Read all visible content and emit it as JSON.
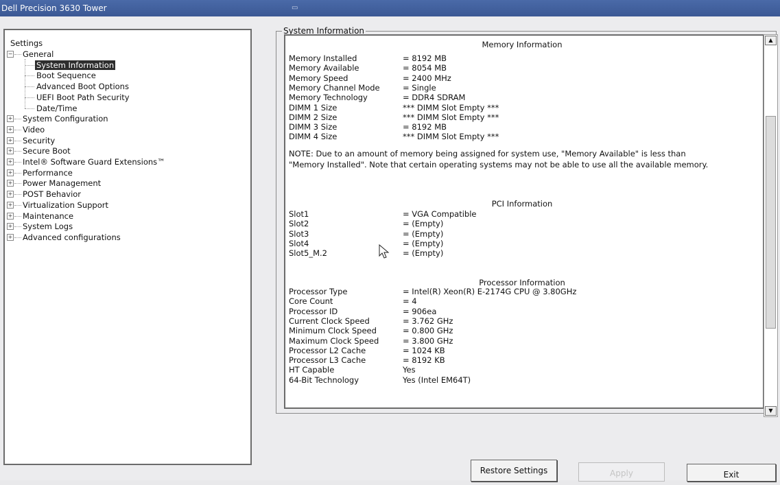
{
  "window": {
    "title": "Dell Precision 3630 Tower"
  },
  "tree": {
    "root": "Settings",
    "general": {
      "label": "General",
      "children": [
        "System Information",
        "Boot Sequence",
        "Advanced Boot Options",
        "UEFI Boot Path Security",
        "Date/Time"
      ],
      "selected": "System Information"
    },
    "top_items": [
      "System Configuration",
      "Video",
      "Security",
      "Secure Boot",
      "Intel® Software Guard Extensions™",
      "Performance",
      "Power Management",
      "POST Behavior",
      "Virtualization Support",
      "Maintenance",
      "System Logs",
      "Advanced configurations"
    ]
  },
  "panel": {
    "group_title": "System Information",
    "memory": {
      "title": "Memory Information",
      "rows": [
        {
          "k": "Memory Installed",
          "v": "= 8192 MB"
        },
        {
          "k": "Memory Available",
          "v": "= 8054 MB"
        },
        {
          "k": "Memory Speed",
          "v": "= 2400 MHz"
        },
        {
          "k": "Memory Channel Mode",
          "v": "= Single"
        },
        {
          "k": "Memory Technology",
          "v": "= DDR4 SDRAM"
        },
        {
          "k": "DIMM 1 Size",
          "v": "*** DIMM Slot Empty ***"
        },
        {
          "k": "DIMM 2 Size",
          "v": "*** DIMM Slot Empty ***"
        },
        {
          "k": "DIMM 3 Size",
          "v": "= 8192 MB"
        },
        {
          "k": "DIMM 4 Size",
          "v": "*** DIMM Slot Empty ***"
        }
      ],
      "note": "NOTE: Due to an amount of memory being assigned for system use, \"Memory Available\" is less than \"Memory Installed\". Note that certain operating systems may not be able to use all the available memory."
    },
    "pci": {
      "title": "PCI Information",
      "rows": [
        {
          "k": "Slot1",
          "v": "= VGA Compatible"
        },
        {
          "k": "Slot2",
          "v": "= (Empty)"
        },
        {
          "k": "Slot3",
          "v": "= (Empty)"
        },
        {
          "k": "Slot4",
          "v": "= (Empty)"
        },
        {
          "k": "Slot5_M.2",
          "v": "= (Empty)"
        }
      ]
    },
    "processor": {
      "title": "Processor Information",
      "rows": [
        {
          "k": "Processor Type",
          "v": "= Intel(R) Xeon(R) E-2174G CPU @ 3.80GHz"
        },
        {
          "k": "Core Count",
          "v": "= 4"
        },
        {
          "k": "Processor ID",
          "v": "= 906ea"
        },
        {
          "k": "Current Clock Speed",
          "v": "= 3.762 GHz"
        },
        {
          "k": "Minimum Clock Speed",
          "v": "= 0.800 GHz"
        },
        {
          "k": "Maximum Clock Speed",
          "v": "= 3.800 GHz"
        },
        {
          "k": "Processor L2 Cache",
          "v": "= 1024 KB"
        },
        {
          "k": "Processor L3 Cache",
          "v": "= 8192 KB"
        },
        {
          "k": "HT Capable",
          "v": "Yes"
        },
        {
          "k": "64-Bit Technology",
          "v": "Yes (Intel EM64T)"
        }
      ]
    }
  },
  "buttons": {
    "restore": "Restore Settings",
    "apply": "Apply",
    "exit": "Exit"
  },
  "icons": {
    "scroll_up": "scroll-up-arrow-icon",
    "scroll_down": "scroll-down-arrow-icon",
    "cursor": "mouse-pointer-icon"
  }
}
